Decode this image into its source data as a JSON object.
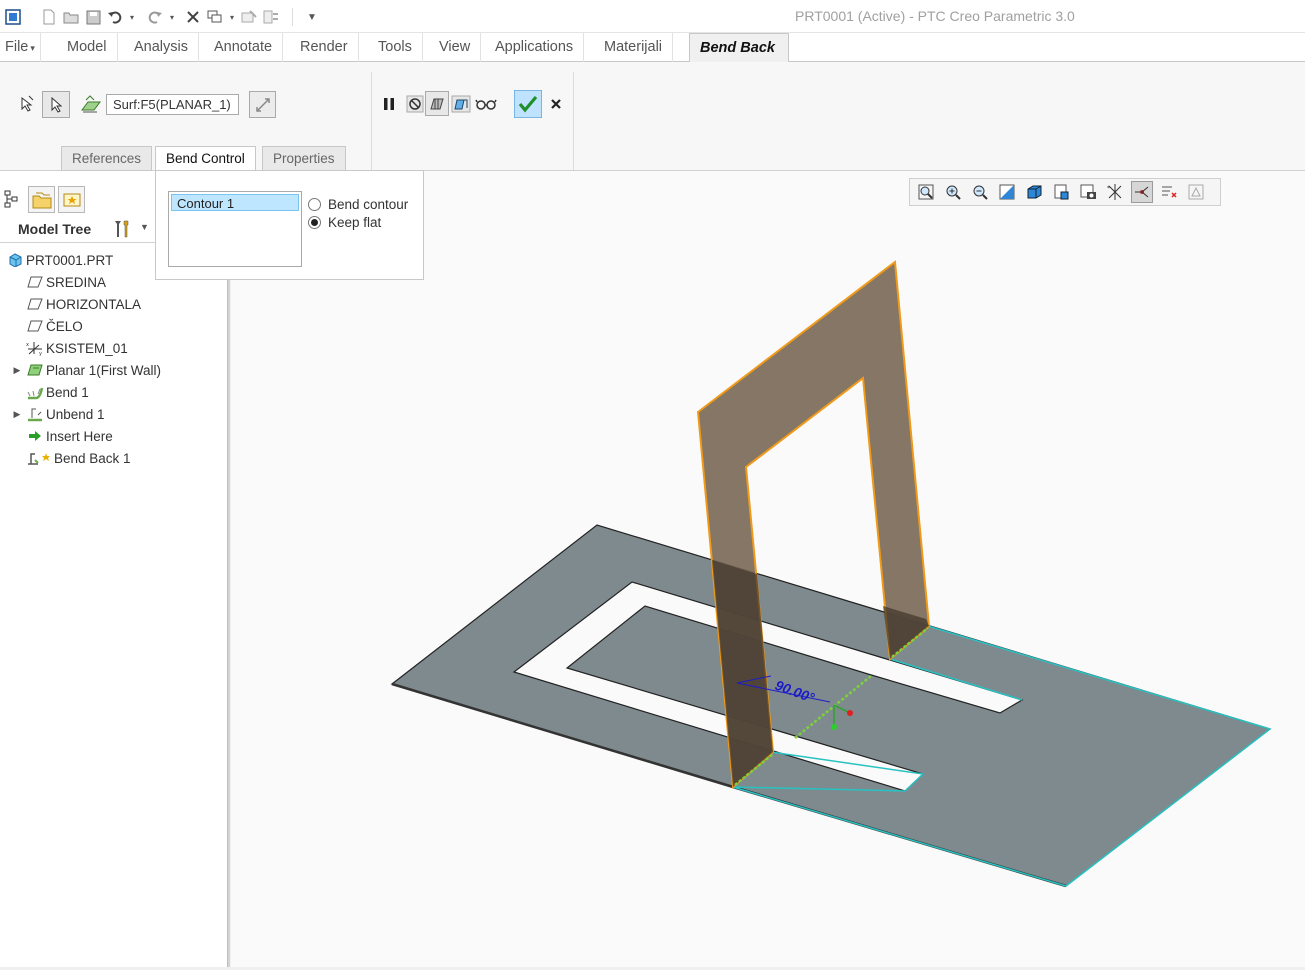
{
  "window": {
    "title": "PRT0001 (Active) - PTC Creo Parametric 3.0"
  },
  "menu": {
    "file": "File",
    "file_arrow": "▾",
    "tabs": [
      "Model",
      "Analysis",
      "Annotate",
      "Render",
      "Tools",
      "View",
      "Applications",
      "Materijali"
    ],
    "active_tab": "Bend Back"
  },
  "ribbon": {
    "surface_reference": "Surf:F5(PLANAR_1)",
    "panel_tabs": [
      "References",
      "Bend Control",
      "Properties"
    ],
    "active_panel_tab": "Bend Control"
  },
  "bend_control": {
    "contours": [
      "Contour 1"
    ],
    "options": [
      "Bend contour",
      "Keep flat"
    ],
    "selected_option": "Keep flat"
  },
  "model_tree": {
    "label": "Model Tree",
    "items": [
      {
        "label": "PRT0001.PRT",
        "icon": "part-icon",
        "expandable": false
      },
      {
        "label": "SREDINA",
        "icon": "datum-plane-icon",
        "expandable": false
      },
      {
        "label": "HORIZONTALA",
        "icon": "datum-plane-icon",
        "expandable": false
      },
      {
        "label": "ČELO",
        "icon": "datum-plane-icon",
        "expandable": false
      },
      {
        "label": "KSISTEM_01",
        "icon": "coordinate-system-icon",
        "expandable": false
      },
      {
        "label": "Planar 1(First Wall)",
        "icon": "planar-wall-icon",
        "expandable": true
      },
      {
        "label": "Bend 1",
        "icon": "bend-icon",
        "expandable": false
      },
      {
        "label": "Unbend 1",
        "icon": "unbend-icon",
        "expandable": true
      },
      {
        "label": "Insert Here",
        "icon": "insert-here-arrow-icon",
        "expandable": false
      },
      {
        "label": "Bend Back 1",
        "icon": "bend-back-icon",
        "expandable": false
      }
    ]
  },
  "graphics": {
    "dimension_label": "90.00°",
    "colors": {
      "sheet_fill": "#7f8a8f",
      "wall_fill": "#7b6a58",
      "wall_edge": "#f09a1a",
      "edge_highlight": "#27c2c2",
      "dimension": "#1d1dc8",
      "background": "#fafafa"
    }
  }
}
